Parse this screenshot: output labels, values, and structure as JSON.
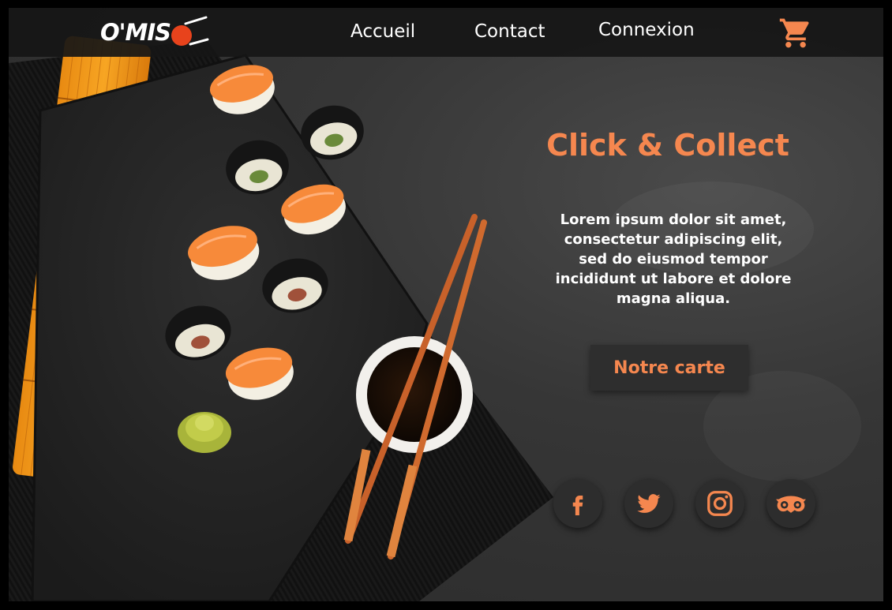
{
  "brand": {
    "logo_text": "O'MIS"
  },
  "nav": {
    "items": [
      {
        "label": "Accueil"
      },
      {
        "label": "Contact"
      },
      {
        "label": "Connexion"
      }
    ],
    "cart_icon": "shopping-cart-icon"
  },
  "hero": {
    "title": "Click & Collect",
    "description": "Lorem ipsum dolor sit amet, consectetur adipiscing elit, sed do eiusmod tempor incididunt ut labore et dolore magna aliqua.",
    "cta_label": "Notre carte"
  },
  "social": [
    {
      "icon": "facebook-icon"
    },
    {
      "icon": "twitter-icon"
    },
    {
      "icon": "instagram-icon"
    },
    {
      "icon": "tripadvisor-icon"
    }
  ],
  "colors": {
    "accent": "#f5874f",
    "header_bg": "#161616",
    "background": "#333333",
    "logo_dot": "#e8431c"
  }
}
